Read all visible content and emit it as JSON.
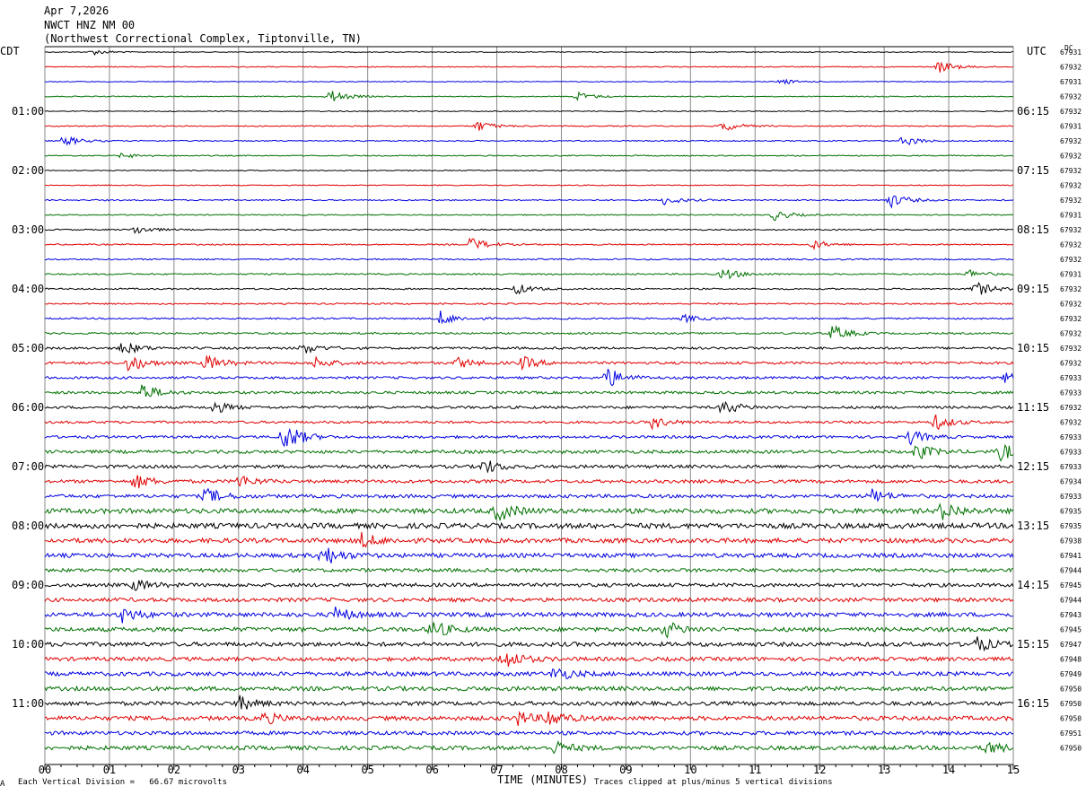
{
  "header": {
    "date": "Apr 7,2026",
    "station": "NWCT HNZ NM 00",
    "location": "(Northwest Correctional Complex, Tiptonville, TN)"
  },
  "left_tz": "CDT",
  "right_tz": "UTC",
  "right_top_note": "DC",
  "footer": {
    "left_symbol": "A",
    "scale_note": "Each Vertical Division =   66.67 microvolts",
    "clip_note": "Traces clipped at plus/minus 5 vertical divisions"
  },
  "chart_data": {
    "type": "helicorder",
    "xlabel": "TIME (MINUTES)",
    "x_ticks": [
      "00",
      "01",
      "02",
      "03",
      "04",
      "05",
      "06",
      "07",
      "08",
      "09",
      "10",
      "11",
      "12",
      "13",
      "14",
      "15"
    ],
    "xlim": [
      0,
      15
    ],
    "trace_colors": [
      "#000000",
      "#e00000",
      "#0000e0",
      "#007000"
    ],
    "trace_count": 48,
    "left_hour_labels": [
      {
        "row": 4,
        "label": "01:00"
      },
      {
        "row": 8,
        "label": "02:00"
      },
      {
        "row": 12,
        "label": "03:00"
      },
      {
        "row": 16,
        "label": "04:00"
      },
      {
        "row": 20,
        "label": "05:00"
      },
      {
        "row": 24,
        "label": "06:00"
      },
      {
        "row": 28,
        "label": "07:00"
      },
      {
        "row": 32,
        "label": "08:00"
      },
      {
        "row": 36,
        "label": "09:00"
      },
      {
        "row": 40,
        "label": "10:00"
      },
      {
        "row": 44,
        "label": "11:00"
      }
    ],
    "right_hour_labels": [
      {
        "row": 4,
        "label": "06:15"
      },
      {
        "row": 8,
        "label": "07:15"
      },
      {
        "row": 12,
        "label": "08:15"
      },
      {
        "row": 16,
        "label": "09:15"
      },
      {
        "row": 20,
        "label": "10:15"
      },
      {
        "row": 24,
        "label": "11:15"
      },
      {
        "row": 28,
        "label": "12:15"
      },
      {
        "row": 32,
        "label": "13:15"
      },
      {
        "row": 36,
        "label": "14:15"
      },
      {
        "row": 40,
        "label": "15:15"
      },
      {
        "row": 44,
        "label": "16:15"
      }
    ],
    "dc_offsets": [
      "67931",
      "67932",
      "67931",
      "67932",
      "67932",
      "67931",
      "67932",
      "67932",
      "67932",
      "67932",
      "67932",
      "67931",
      "67932",
      "67932",
      "67932",
      "67931",
      "67932",
      "67932",
      "67932",
      "67932",
      "67932",
      "67932",
      "67933",
      "67933",
      "67932",
      "67932",
      "67933",
      "67933",
      "67933",
      "67934",
      "67933",
      "67935",
      "67935",
      "67938",
      "67941",
      "67944",
      "67945",
      "67944",
      "67943",
      "67945",
      "67947",
      "67948",
      "67949",
      "67950",
      "67950",
      "67950",
      "67951",
      "67950"
    ],
    "noise_level": [
      0.5,
      0.6,
      0.5,
      0.6,
      0.6,
      0.7,
      0.7,
      0.7,
      0.6,
      0.6,
      0.8,
      0.7,
      0.8,
      0.8,
      0.9,
      0.9,
      0.9,
      0.9,
      1.0,
      1.1,
      1.4,
      1.6,
      1.5,
      1.6,
      1.6,
      1.5,
      1.6,
      2.0,
      2.0,
      2.0,
      2.1,
      3.0,
      3.2,
      2.8,
      2.6,
      2.2,
      2.2,
      2.4,
      2.6,
      2.6,
      2.6,
      2.4,
      2.5,
      2.6,
      2.4,
      2.6,
      2.3,
      2.5
    ],
    "events": [
      {
        "row": 0,
        "t": 0.75,
        "amp": 3
      },
      {
        "row": 1,
        "t": 13.85,
        "amp": 7
      },
      {
        "row": 2,
        "t": 11.4,
        "amp": 3
      },
      {
        "row": 3,
        "t": 4.4,
        "amp": 8
      },
      {
        "row": 3,
        "t": 8.25,
        "amp": 5
      },
      {
        "row": 5,
        "t": 6.7,
        "amp": 6
      },
      {
        "row": 5,
        "t": 10.5,
        "amp": 6
      },
      {
        "row": 6,
        "t": 0.3,
        "amp": 6
      },
      {
        "row": 6,
        "t": 13.3,
        "amp": 6
      },
      {
        "row": 7,
        "t": 1.2,
        "amp": 3
      },
      {
        "row": 10,
        "t": 9.6,
        "amp": 5
      },
      {
        "row": 10,
        "t": 13.1,
        "amp": 8
      },
      {
        "row": 11,
        "t": 11.3,
        "amp": 6
      },
      {
        "row": 12,
        "t": 1.4,
        "amp": 5
      },
      {
        "row": 13,
        "t": 6.6,
        "amp": 8
      },
      {
        "row": 13,
        "t": 11.9,
        "amp": 5
      },
      {
        "row": 15,
        "t": 10.5,
        "amp": 7
      },
      {
        "row": 15,
        "t": 14.3,
        "amp": 5
      },
      {
        "row": 16,
        "t": 7.3,
        "amp": 6
      },
      {
        "row": 16,
        "t": 14.4,
        "amp": 9
      },
      {
        "row": 18,
        "t": 6.1,
        "amp": 9
      },
      {
        "row": 18,
        "t": 9.9,
        "amp": 4
      },
      {
        "row": 19,
        "t": 12.2,
        "amp": 9
      },
      {
        "row": 20,
        "t": 1.2,
        "amp": 8
      },
      {
        "row": 20,
        "t": 4.0,
        "amp": 6
      },
      {
        "row": 21,
        "t": 1.3,
        "amp": 10
      },
      {
        "row": 21,
        "t": 2.5,
        "amp": 9
      },
      {
        "row": 21,
        "t": 4.2,
        "amp": 6
      },
      {
        "row": 21,
        "t": 6.4,
        "amp": 6
      },
      {
        "row": 21,
        "t": 7.4,
        "amp": 7
      },
      {
        "row": 22,
        "t": 8.7,
        "amp": 12
      },
      {
        "row": 22,
        "t": 14.9,
        "amp": 7
      },
      {
        "row": 23,
        "t": 1.5,
        "amp": 10
      },
      {
        "row": 24,
        "t": 2.6,
        "amp": 7
      },
      {
        "row": 24,
        "t": 10.5,
        "amp": 8
      },
      {
        "row": 25,
        "t": 9.4,
        "amp": 7
      },
      {
        "row": 25,
        "t": 13.8,
        "amp": 8
      },
      {
        "row": 26,
        "t": 3.7,
        "amp": 18
      },
      {
        "row": 26,
        "t": 13.4,
        "amp": 8
      },
      {
        "row": 27,
        "t": 13.5,
        "amp": 9
      },
      {
        "row": 27,
        "t": 14.8,
        "amp": 10
      },
      {
        "row": 28,
        "t": 6.8,
        "amp": 8
      },
      {
        "row": 29,
        "t": 1.4,
        "amp": 8
      },
      {
        "row": 29,
        "t": 3.0,
        "amp": 7
      },
      {
        "row": 30,
        "t": 2.5,
        "amp": 9
      },
      {
        "row": 30,
        "t": 12.8,
        "amp": 8
      },
      {
        "row": 31,
        "t": 7.0,
        "amp": 11
      },
      {
        "row": 31,
        "t": 13.9,
        "amp": 10
      },
      {
        "row": 33,
        "t": 4.9,
        "amp": 8
      },
      {
        "row": 34,
        "t": 4.3,
        "amp": 12
      },
      {
        "row": 36,
        "t": 1.4,
        "amp": 6
      },
      {
        "row": 38,
        "t": 1.2,
        "amp": 8
      },
      {
        "row": 38,
        "t": 4.5,
        "amp": 8
      },
      {
        "row": 39,
        "t": 6.0,
        "amp": 10
      },
      {
        "row": 39,
        "t": 9.6,
        "amp": 9
      },
      {
        "row": 40,
        "t": 14.4,
        "amp": 9
      },
      {
        "row": 41,
        "t": 7.1,
        "amp": 12
      },
      {
        "row": 42,
        "t": 7.9,
        "amp": 8
      },
      {
        "row": 44,
        "t": 3.0,
        "amp": 8
      },
      {
        "row": 45,
        "t": 3.4,
        "amp": 6
      },
      {
        "row": 45,
        "t": 7.3,
        "amp": 8
      },
      {
        "row": 45,
        "t": 7.8,
        "amp": 9
      },
      {
        "row": 47,
        "t": 14.6,
        "amp": 7
      },
      {
        "row": 47,
        "t": 7.9,
        "amp": 7
      }
    ]
  }
}
